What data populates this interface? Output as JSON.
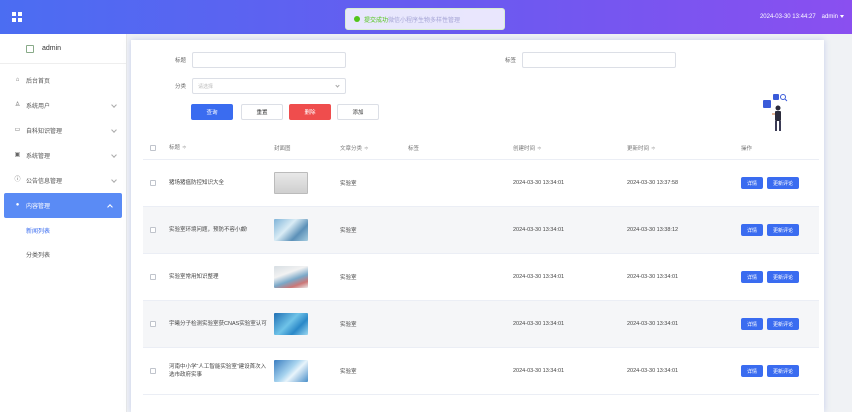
{
  "topbar": {
    "toast_text": "提交成功",
    "title_ghost": "微信小程序生物多样性管理",
    "datetime": "2024-03-30 13:44:27",
    "user": "admin"
  },
  "sidebar": {
    "username": "admin",
    "items": [
      {
        "label": "后台首页",
        "icon": "home-icon"
      },
      {
        "label": "系统用户",
        "icon": "user-icon"
      },
      {
        "label": "自科知识管理",
        "icon": "book-icon"
      },
      {
        "label": "系统管理",
        "icon": "settings-icon"
      },
      {
        "label": "公告信息管理",
        "icon": "notice-icon"
      },
      {
        "label": "内容管理",
        "icon": "content-icon"
      }
    ],
    "subitems": [
      {
        "label": "新闻列表"
      },
      {
        "label": "分类列表"
      }
    ]
  },
  "search": {
    "title_label": "标题",
    "tag_label": "标签",
    "category_label": "分类",
    "category_placeholder": "请选择",
    "btn_query": "查询",
    "btn_reset": "重置",
    "btn_delete": "删除",
    "btn_add": "添加"
  },
  "table": {
    "headers": {
      "title": "标题",
      "cover": "封面图",
      "category": "文章分类",
      "tag": "标签",
      "created": "创建时间",
      "updated": "更新时间",
      "ops": "操作"
    },
    "sort_mark": "≑",
    "rows": [
      {
        "title": "猪场猪瘟防控知识大全",
        "category": "实验室",
        "tag": "",
        "created": "2024-03-30 13:34:01",
        "updated": "2024-03-30 13:37:58",
        "thumb": "t1"
      },
      {
        "title": "实验室环境问题，预防不容小觑!",
        "category": "实验室",
        "tag": "",
        "created": "2024-03-30 13:34:01",
        "updated": "2024-03-30 13:38:12",
        "thumb": "t2"
      },
      {
        "title": "实验室常用知识整理",
        "category": "实验室",
        "tag": "",
        "created": "2024-03-30 13:34:01",
        "updated": "2024-03-30 13:34:01",
        "thumb": "t3"
      },
      {
        "title": "宇曦分子检测实验室获CNAS实验室认可",
        "category": "实验室",
        "tag": "",
        "created": "2024-03-30 13:34:01",
        "updated": "2024-03-30 13:34:01",
        "thumb": "t4"
      },
      {
        "title": "河南中小学“人工智能实验室”建设首次入选市政府实事",
        "category": "实验室",
        "tag": "",
        "created": "2024-03-30 13:34:01",
        "updated": "2024-03-30 13:34:01",
        "thumb": "t5"
      }
    ],
    "op_detail": "详情",
    "op_edit": "更新评论"
  }
}
